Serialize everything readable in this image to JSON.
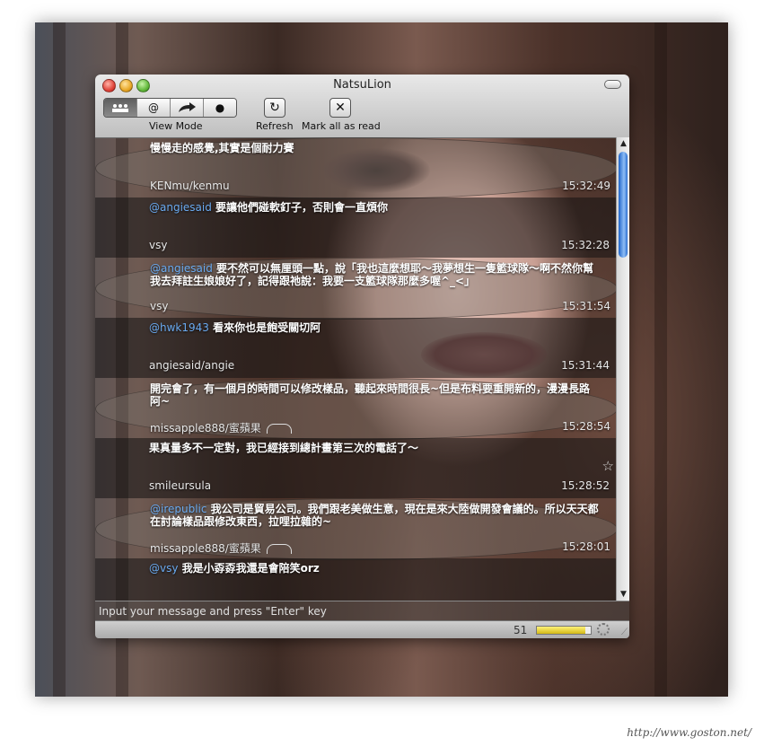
{
  "window": {
    "title": "NatsuLion"
  },
  "toolbar": {
    "view_mode_label": "View Mode",
    "view_mode_segments": [
      "friends-icon",
      "at-icon",
      "retweet-icon",
      "dot-icon"
    ],
    "view_mode_at_glyph": "@",
    "view_mode_dot_glyph": "●",
    "refresh_label": "Refresh",
    "refresh_glyph": "↻",
    "mark_read_label": "Mark all as read",
    "mark_read_glyph": "✕"
  },
  "messages": [
    {
      "mention": "",
      "text": "慢慢走的感覺,其實是個耐力賽",
      "user": "KENmu/kenmu",
      "time": "15:32:49",
      "tone": "light"
    },
    {
      "mention": "@angiesaid",
      "text": " 要讓他們碰軟釘子，否則會一直煩你",
      "user": "vsy",
      "time": "15:32:28",
      "tone": "dark"
    },
    {
      "mention": "@angiesaid",
      "text": " 要不然可以無厘頭一點，說「我也這麼想耶～我夢想生一隻籃球隊～啊不然你幫我去拜註生娘娘好了，記得跟祂說：我要一支籃球隊那麼多喔^_<」",
      "user": "vsy",
      "time": "15:31:54",
      "tone": "light"
    },
    {
      "mention": "@hwk1943",
      "text": " 看來你也是飽受關切阿",
      "user": "angiesaid/angie",
      "time": "15:31:44",
      "tone": "dark"
    },
    {
      "mention": "",
      "text": "開完會了，有一個月的時間可以修改樣品，聽起來時間很長~但是布料要重開新的，漫漫長路阿~",
      "user": "missapple888/蜜蘋果",
      "time": "15:28:54",
      "tone": "light"
    },
    {
      "mention": "",
      "text": "果真量多不一定對，我已經接到總計畫第三次的電話了～",
      "user": "smileursula",
      "time": "15:28:52",
      "tone": "dark"
    },
    {
      "mention": "@irepublic",
      "text": " 我公司是貿易公司。我們跟老美做生意，現在是來大陸做開發會議的。所以天天都在討論樣品跟修改東西，拉哩拉雜的~",
      "user": "missapple888/蜜蘋果",
      "time": "15:28:01",
      "tone": "light"
    },
    {
      "mention": "@vsy",
      "text": " 我是小孬孬我還是會陪笑orz",
      "user": "",
      "time": "",
      "tone": "dark"
    }
  ],
  "input": {
    "placeholder": "Input your message and press \"Enter\" key"
  },
  "status": {
    "count": "51",
    "meter_fraction": 0.9
  },
  "watermark": "http://www.goston.net/"
}
